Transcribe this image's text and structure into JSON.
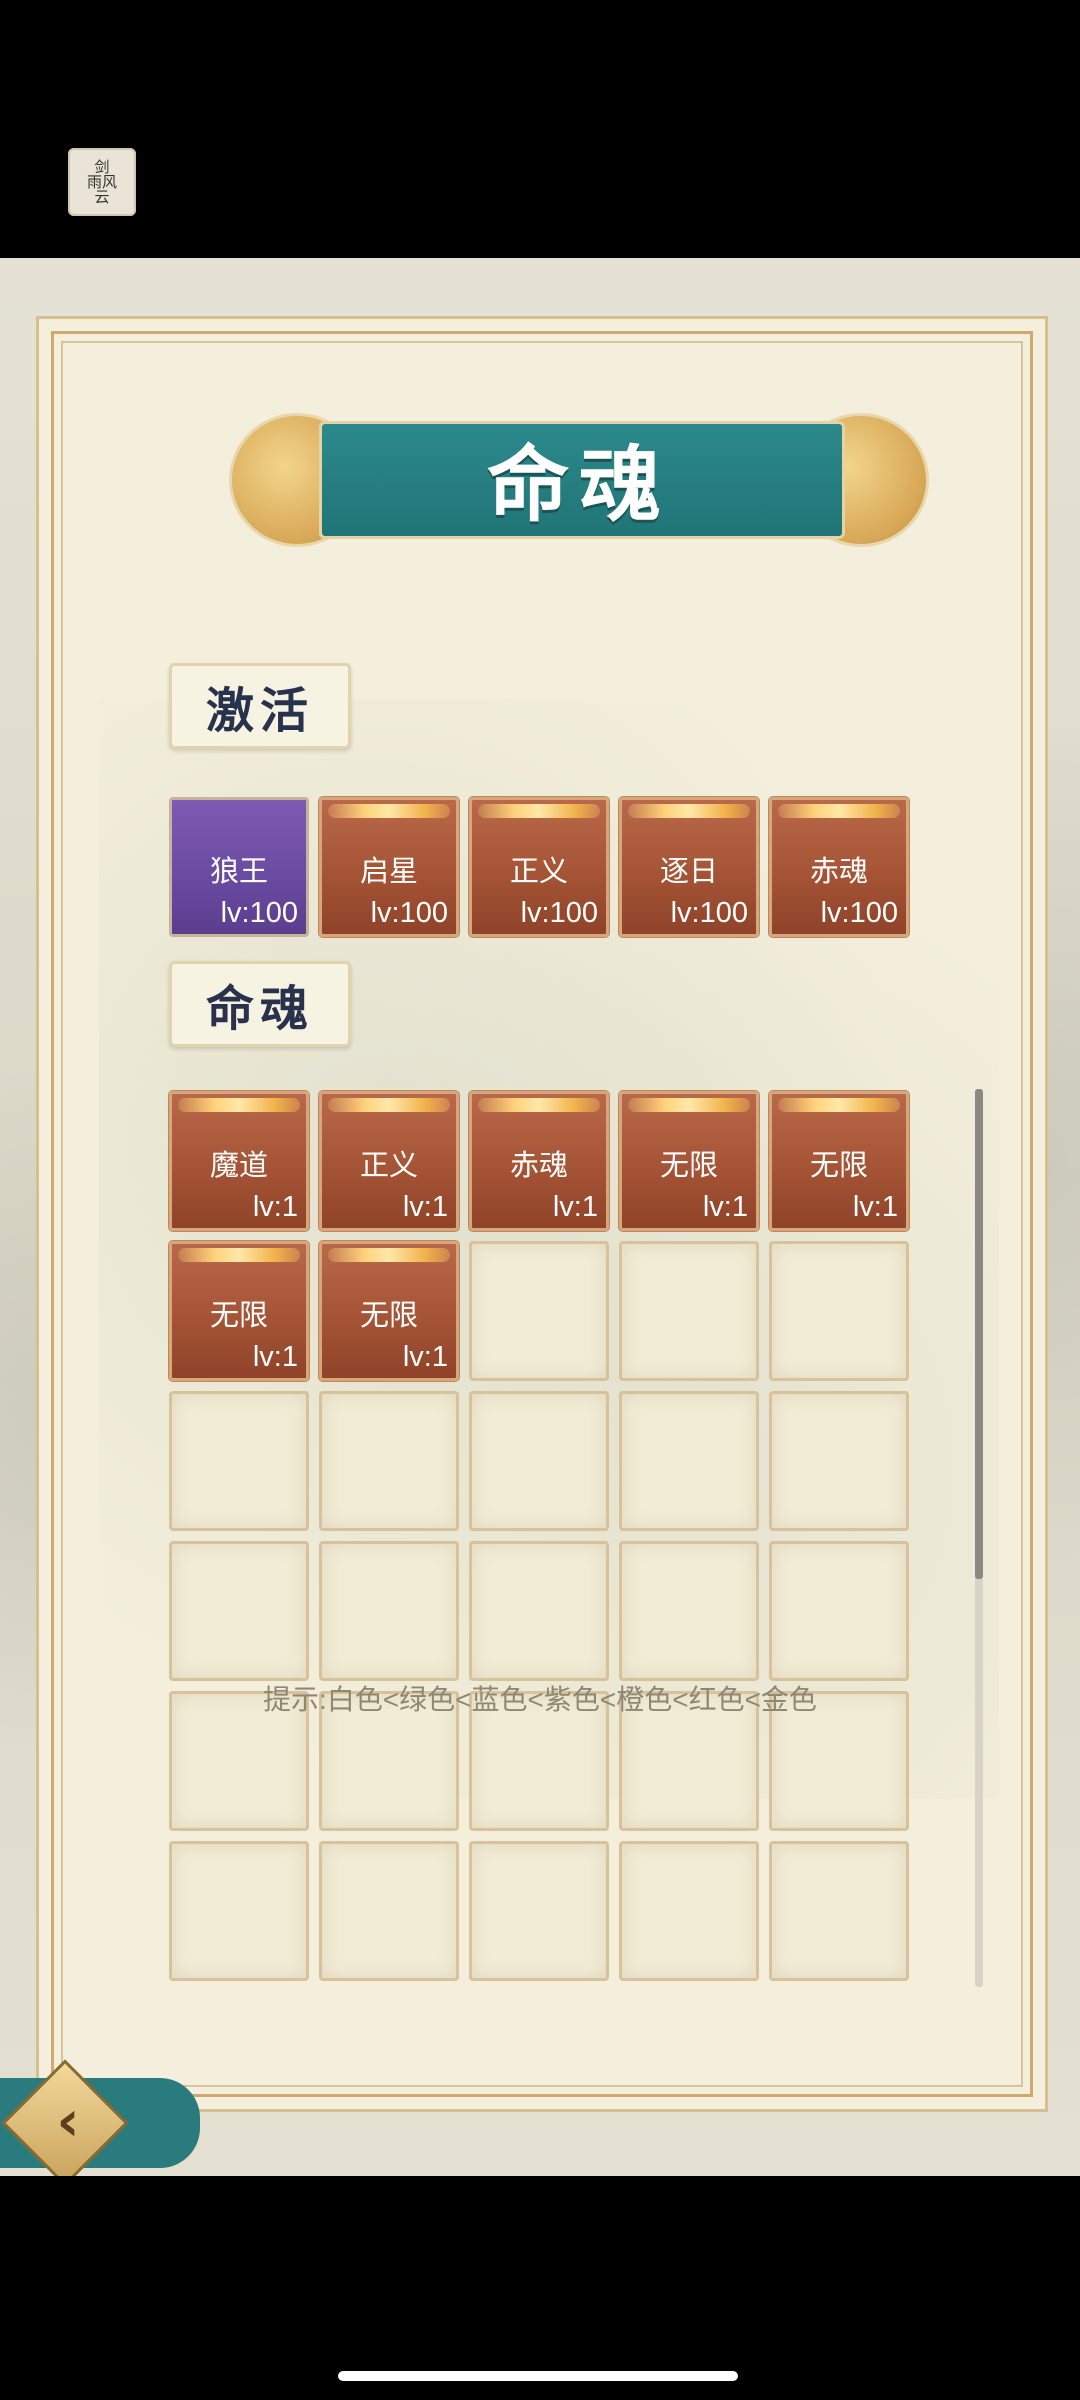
{
  "app_logo": {
    "text": "剑\n雨风\n云"
  },
  "title": "命魂",
  "sections": {
    "activated": {
      "label": "激活"
    },
    "souls": {
      "label": "命魂"
    }
  },
  "activated_slots": [
    {
      "name": "狼王",
      "level": "lv:100",
      "color": "purple"
    },
    {
      "name": "启星",
      "level": "lv:100",
      "color": "red"
    },
    {
      "name": "正义",
      "level": "lv:100",
      "color": "red"
    },
    {
      "name": "逐日",
      "level": "lv:100",
      "color": "red"
    },
    {
      "name": "赤魂",
      "level": "lv:100",
      "color": "red"
    }
  ],
  "soul_slots": [
    {
      "name": "魔道",
      "level": "lv:1"
    },
    {
      "name": "正义",
      "level": "lv:1"
    },
    {
      "name": "赤魂",
      "level": "lv:1"
    },
    {
      "name": "无限",
      "level": "lv:1"
    },
    {
      "name": "无限",
      "level": "lv:1"
    },
    {
      "name": "无限",
      "level": "lv:1"
    },
    {
      "name": "无限",
      "level": "lv:1"
    }
  ],
  "soul_grid": {
    "columns": 5,
    "rows": 6
  },
  "hint": "提示:白色<绿色<蓝色<紫色<橙色<红色<金色",
  "colors": {
    "slot_red": "#a35234",
    "slot_purple": "#6a4aa0",
    "title_teal": "#2c8a8c",
    "accent_gold": "#d8a67a"
  },
  "icons": {
    "back": "back-arrow-icon"
  }
}
